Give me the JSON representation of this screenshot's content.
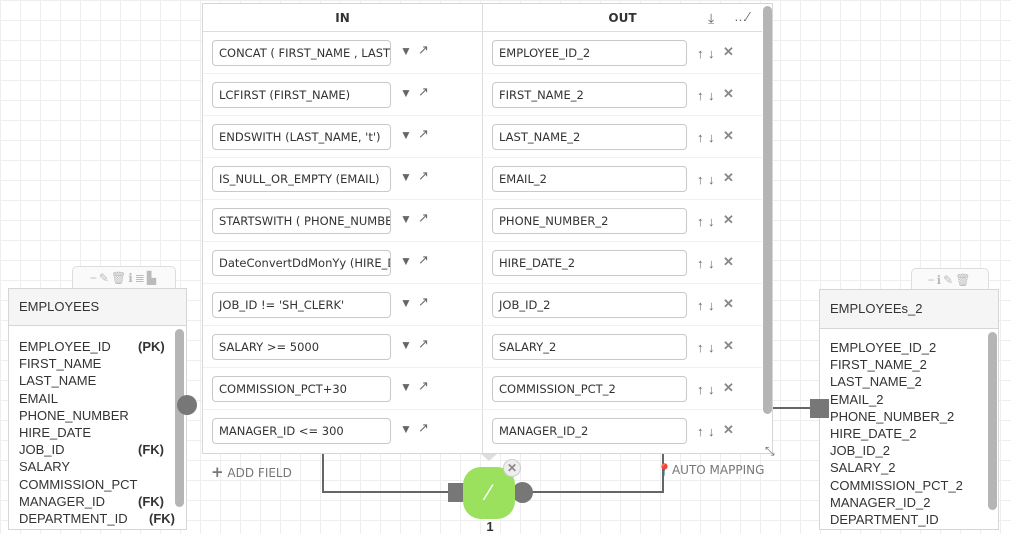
{
  "mapping": {
    "in_header": "IN",
    "out_header": "OUT",
    "rows": [
      {
        "in": "CONCAT ( FIRST_NAME , LAST_NAME )",
        "out": "EMPLOYEE_ID_2"
      },
      {
        "in": "LCFIRST (FIRST_NAME)",
        "out": "FIRST_NAME_2"
      },
      {
        "in": "ENDSWITH (LAST_NAME, 't')",
        "out": "LAST_NAME_2"
      },
      {
        "in": "IS_NULL_OR_EMPTY (EMAIL)",
        "out": "EMAIL_2"
      },
      {
        "in": "STARTSWITH ( PHONE_NUMBER",
        "out": "PHONE_NUMBER_2"
      },
      {
        "in": "DateConvertDdMonYy (HIRE_DATE",
        "out": "HIRE_DATE_2"
      },
      {
        "in": "JOB_ID != 'SH_CLERK'",
        "out": "JOB_ID_2"
      },
      {
        "in": "SALARY >= 5000",
        "out": "SALARY_2"
      },
      {
        "in": "COMMISSION_PCT+30",
        "out": "COMMISSION_PCT_2"
      },
      {
        "in": "MANAGER_ID  <= 300",
        "out": "MANAGER_ID_2"
      }
    ],
    "add_field": "ADD FIELD",
    "auto_mapping": "AUTO MAPPING",
    "node_label": "1",
    "node_color": "#9be15d"
  },
  "source_table": {
    "title": "EMPLOYEES",
    "columns": [
      {
        "name": "EMPLOYEE_ID",
        "key": "(PK)"
      },
      {
        "name": "FIRST_NAME",
        "key": ""
      },
      {
        "name": "LAST_NAME",
        "key": ""
      },
      {
        "name": "EMAIL",
        "key": ""
      },
      {
        "name": "PHONE_NUMBER",
        "key": ""
      },
      {
        "name": "HIRE_DATE",
        "key": ""
      },
      {
        "name": "JOB_ID",
        "key": "(FK)"
      },
      {
        "name": "SALARY",
        "key": ""
      },
      {
        "name": "COMMISSION_PCT",
        "key": ""
      },
      {
        "name": "MANAGER_ID",
        "key": "(FK)"
      },
      {
        "name": "DEPARTMENT_ID",
        "key": "(FK)"
      }
    ]
  },
  "target_table": {
    "title": "EMPLOYEEs_2",
    "columns": [
      "EMPLOYEE_ID_2",
      "FIRST_NAME_2",
      "LAST_NAME_2",
      "EMAIL_2",
      "PHONE_NUMBER_2",
      "HIRE_DATE_2",
      "JOB_ID_2",
      "SALARY_2",
      "COMMISSION_PCT_2",
      "MANAGER_ID_2",
      "DEPARTMENT_ID"
    ]
  }
}
